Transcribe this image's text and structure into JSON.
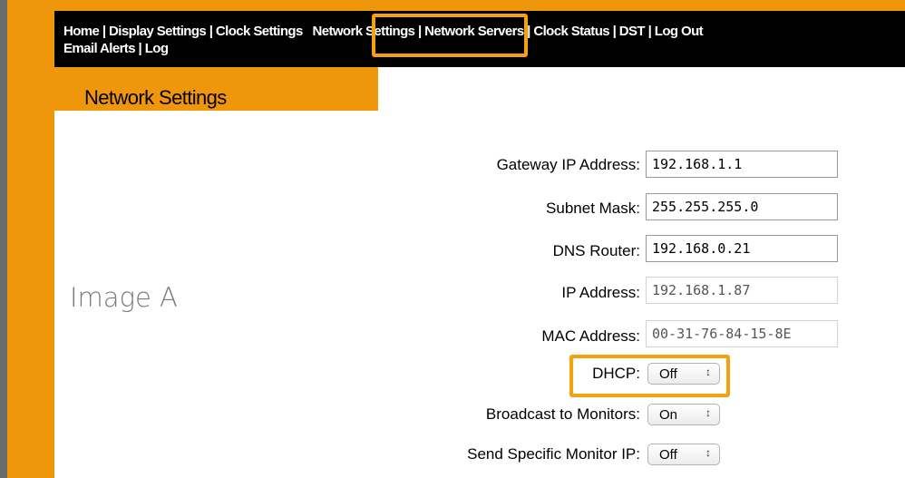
{
  "nav": {
    "line1": [
      "Home",
      "Display Settings",
      "Clock Settings",
      "Network Settings",
      "Network Servers",
      "Clock Status",
      "DST",
      "Log Out"
    ],
    "line2": [
      "Email Alerts",
      "Log"
    ],
    "separator": "|"
  },
  "page_title": "Network Settings",
  "image_label": "Image A",
  "fields": {
    "gateway": {
      "label": "Gateway IP Address:",
      "value": "192.168.1.1"
    },
    "subnet": {
      "label": "Subnet Mask:",
      "value": "255.255.255.0"
    },
    "dns": {
      "label": "DNS Router:",
      "value": "192.168.0.21"
    },
    "ip": {
      "label": "IP Address:",
      "value": "192.168.1.87"
    },
    "mac": {
      "label": "MAC Address:",
      "value": "00-31-76-84-15-8E"
    },
    "dhcp": {
      "label": "DHCP:",
      "value": "Off"
    },
    "broadcast": {
      "label": "Broadcast to Monitors:",
      "value": "On"
    },
    "specific_ip": {
      "label": "Send Specific Monitor IP:",
      "value": "Off"
    }
  },
  "select_arrow": "↕",
  "colors": {
    "accent": "#f0960a",
    "highlight": "#f6a20f",
    "nav_bg": "#000000"
  }
}
